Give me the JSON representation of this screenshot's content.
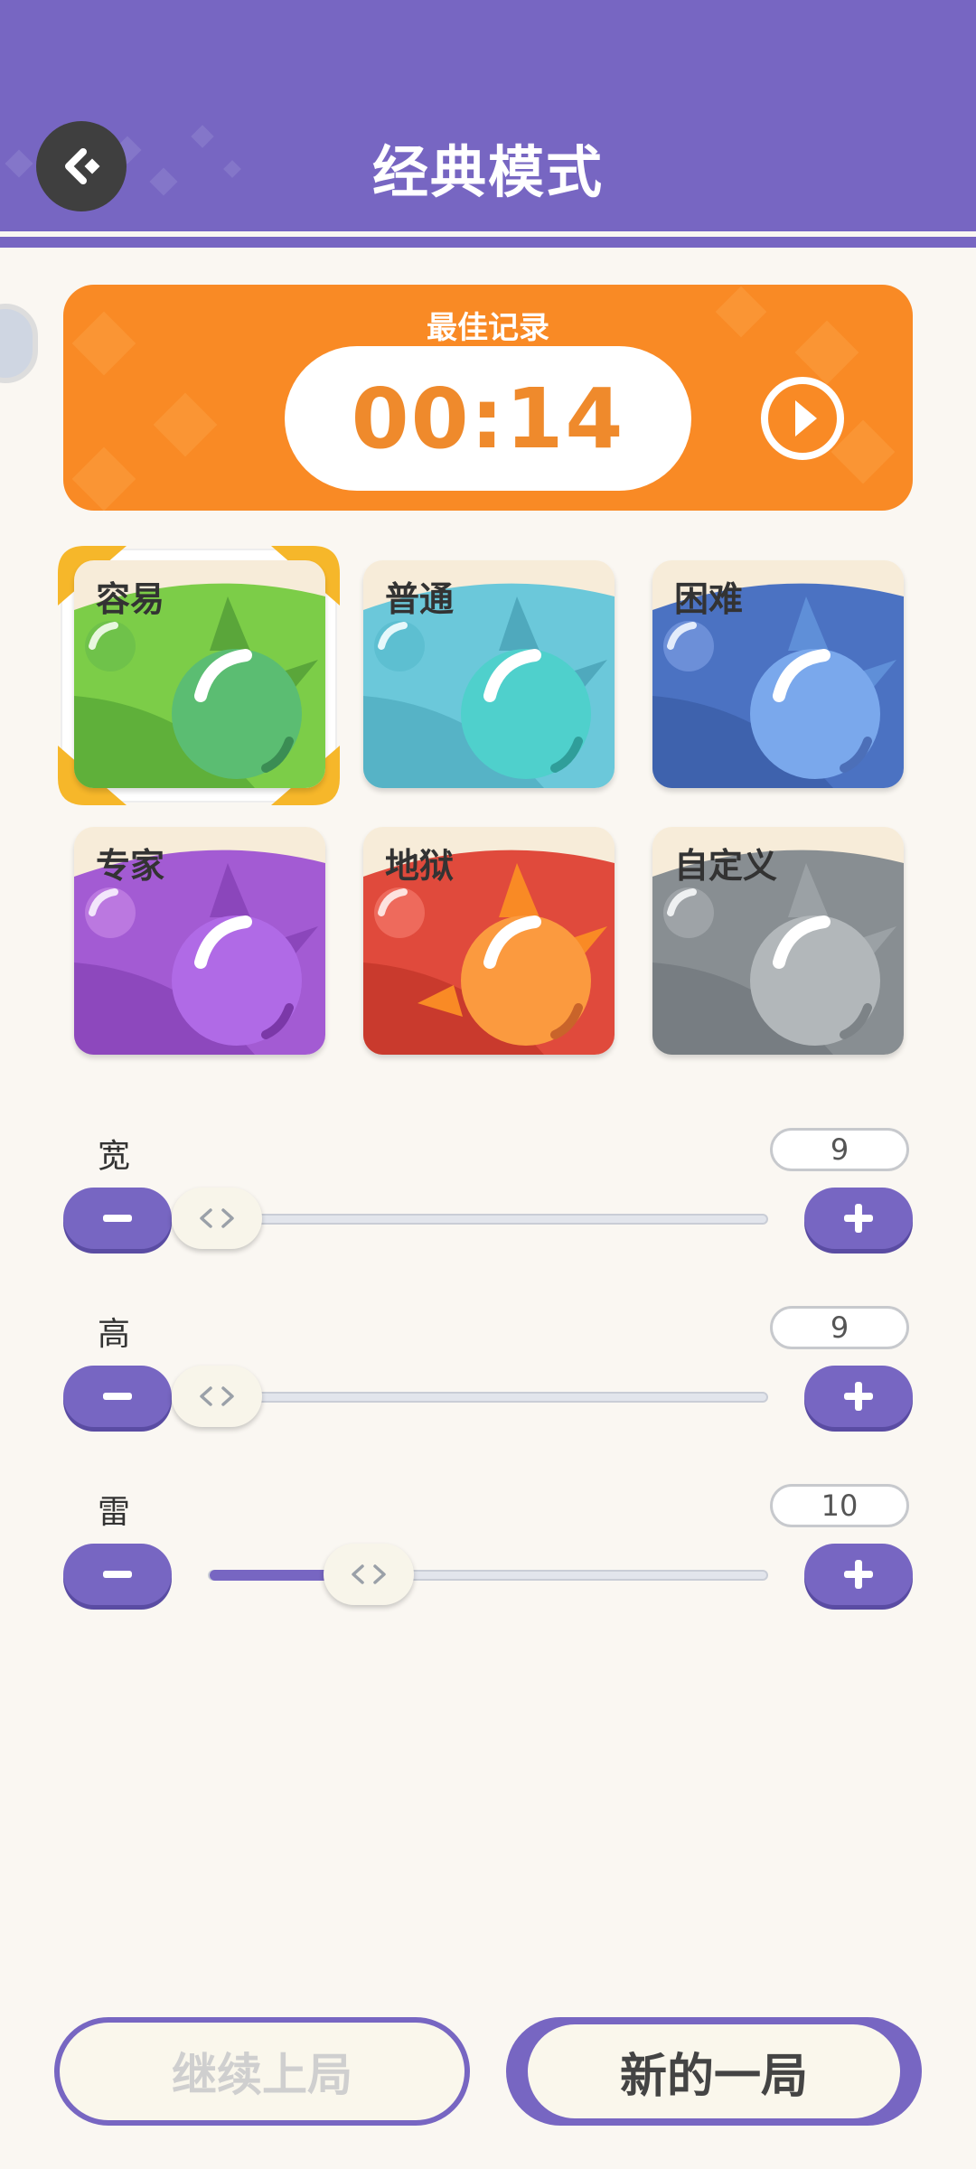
{
  "header": {
    "title": "经典模式"
  },
  "record": {
    "label": "最佳记录",
    "time": "00:14"
  },
  "difficulties": [
    {
      "label": "容易",
      "color": "#6cc243",
      "selected": true
    },
    {
      "label": "普通",
      "color": "#5cc4d8",
      "selected": false
    },
    {
      "label": "困难",
      "color": "#4a6fbf",
      "selected": false
    },
    {
      "label": "专家",
      "color": "#9b55d0",
      "selected": false
    },
    {
      "label": "地狱",
      "color": "#e04a3c",
      "selected": false
    },
    {
      "label": "自定义",
      "color": "#888e92",
      "selected": false
    }
  ],
  "settings": {
    "width": {
      "label": "宽",
      "value": "9",
      "fraction": 0
    },
    "height": {
      "label": "高",
      "value": "9",
      "fraction": 0
    },
    "mines": {
      "label": "雷",
      "value": "10",
      "fraction": 0.22
    }
  },
  "buttons": {
    "continue_label": "继续上局",
    "new_label": "新的一局"
  },
  "colors": {
    "accent": "#7766c2",
    "record": "#f98a25",
    "selected_frame": "#f6b72a"
  },
  "icons": {
    "back": "back-arrow-icon",
    "play": "play-icon",
    "minus": "minus-icon",
    "plus": "plus-icon"
  }
}
